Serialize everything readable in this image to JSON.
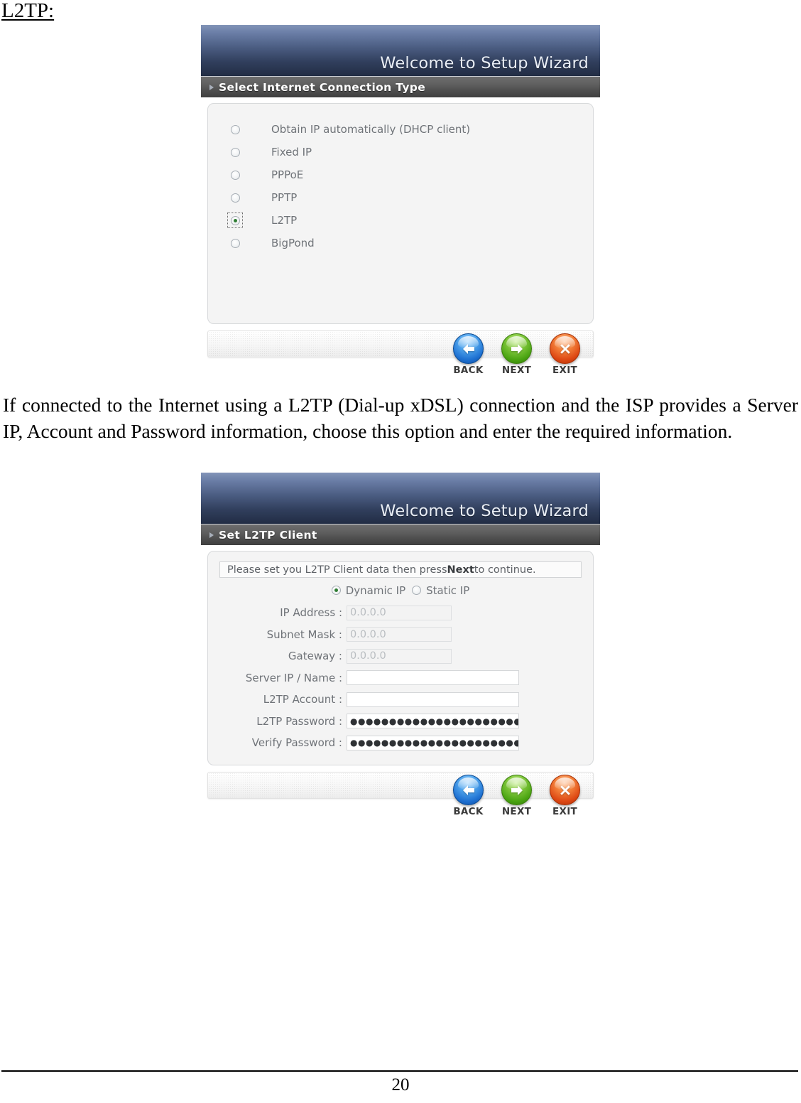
{
  "document": {
    "heading": "L2TP:",
    "paragraph": "If connected to the Internet using a L2TP (Dial-up xDSL) connection and the ISP provides a Server IP, Account and Password information, choose this option and enter the required information.",
    "page_number": "20"
  },
  "wizard_connection_type": {
    "title": "Welcome to Setup Wizard",
    "section": "Select Internet Connection Type",
    "options": [
      {
        "label": "Obtain IP automatically (DHCP client)",
        "checked": false,
        "focused": false
      },
      {
        "label": "Fixed IP",
        "checked": false,
        "focused": false
      },
      {
        "label": "PPPoE",
        "checked": false,
        "focused": false
      },
      {
        "label": "PPTP",
        "checked": false,
        "focused": false
      },
      {
        "label": "L2TP",
        "checked": true,
        "focused": true
      },
      {
        "label": "BigPond",
        "checked": false,
        "focused": false
      }
    ],
    "buttons": [
      {
        "label": "BACK",
        "icon": "arrow-left-icon",
        "color": "#1d6fd0"
      },
      {
        "label": "NEXT",
        "icon": "arrow-right-icon",
        "color": "#49a311"
      },
      {
        "label": "EXIT",
        "icon": "close-x-icon",
        "color": "#dd4713"
      }
    ]
  },
  "wizard_l2tp_client": {
    "title": "Welcome to Setup Wizard",
    "section": "Set L2TP Client",
    "notice_prefix": "Please set you L2TP Client data then press ",
    "notice_bold": "Next",
    "notice_suffix": " to continue.",
    "ip_type": {
      "dynamic_label": "Dynamic IP",
      "static_label": "Static IP",
      "selected": "Dynamic IP"
    },
    "fields": [
      {
        "label": "IP Address :",
        "value": "0.0.0.0",
        "disabled": true,
        "width": "narrow",
        "masked": false
      },
      {
        "label": "Subnet Mask :",
        "value": "0.0.0.0",
        "disabled": true,
        "width": "narrow",
        "masked": false
      },
      {
        "label": "Gateway :",
        "value": "0.0.0.0",
        "disabled": true,
        "width": "narrow",
        "masked": false
      },
      {
        "label": "Server IP / Name :",
        "value": "",
        "disabled": false,
        "width": "wide",
        "masked": false
      },
      {
        "label": "L2TP Account :",
        "value": "",
        "disabled": false,
        "width": "wide",
        "masked": false
      },
      {
        "label": "L2TP Password :",
        "value": "●●●●●●●●●●●●●●●●●●●●●●●●●●●●",
        "disabled": false,
        "width": "wide",
        "masked": true
      },
      {
        "label": "Verify Password :",
        "value": "●●●●●●●●●●●●●●●●●●●●●●●●●●●●",
        "disabled": false,
        "width": "wide",
        "masked": true
      }
    ],
    "buttons": [
      {
        "label": "BACK",
        "icon": "arrow-left-icon",
        "color": "#1d6fd0"
      },
      {
        "label": "NEXT",
        "icon": "arrow-right-icon",
        "color": "#49a311"
      },
      {
        "label": "EXIT",
        "icon": "close-x-icon",
        "color": "#dd4713"
      }
    ]
  }
}
